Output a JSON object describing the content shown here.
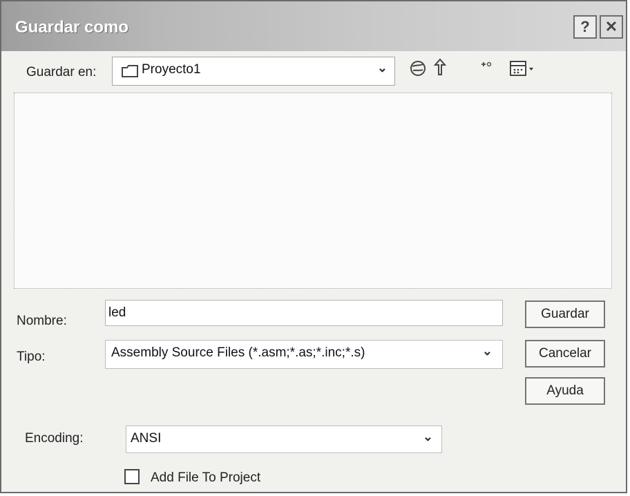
{
  "dialog": {
    "title": "Guardar como",
    "help_button": "?",
    "close_button": "✕"
  },
  "location": {
    "label": "Guardar en:",
    "value": "Proyecto1",
    "folder_icon": "folder-icon",
    "dropdown_icon": "chevron-down-icon"
  },
  "toolbar": {
    "back_icon": "globe-icon",
    "up_icon": "up-folder-icon",
    "new_folder_icon": "new-folder-icon",
    "view_icon": "view-menu-icon"
  },
  "file_list": {
    "items": []
  },
  "form": {
    "name_label": "Nombre:",
    "name_value": "led",
    "type_label": "Tipo:",
    "type_value": "Assembly Source Files (*.asm;*.as;*.inc;*.s)",
    "encoding_label": "Encoding:",
    "encoding_value": "ANSI",
    "add_file_label": "Add File To Project",
    "add_file_checked": false
  },
  "buttons": {
    "save": "Guardar",
    "cancel": "Cancelar",
    "help": "Ayuda"
  }
}
